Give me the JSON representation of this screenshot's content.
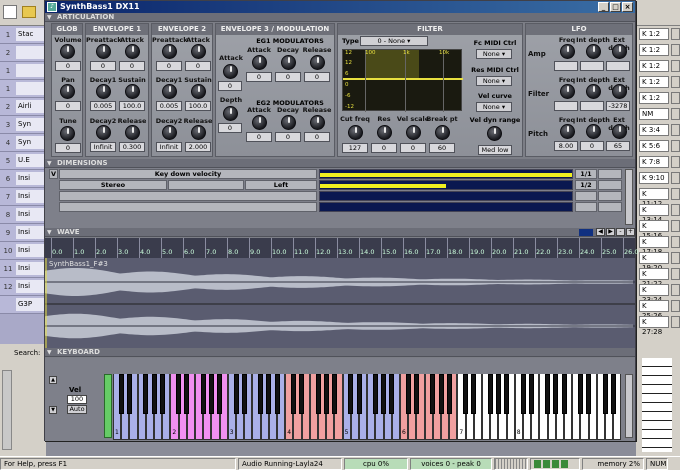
{
  "window": {
    "title": "SynthBass1 DX11"
  },
  "host": {
    "tracks": [
      {
        "num": "1",
        "name": "Stac"
      },
      {
        "num": "2",
        "name": ""
      },
      {
        "num": "1",
        "name": ""
      },
      {
        "num": "1",
        "name": ""
      },
      {
        "num": "2",
        "name": "Airli"
      },
      {
        "num": "3",
        "name": "Syn"
      },
      {
        "num": "4",
        "name": "Syn"
      },
      {
        "num": "5",
        "name": "U.E"
      },
      {
        "num": "6",
        "name": "Insi"
      },
      {
        "num": "7",
        "name": "Insi"
      },
      {
        "num": "8",
        "name": "Insi"
      },
      {
        "num": "9",
        "name": "Insi"
      },
      {
        "num": "10",
        "name": "Insi"
      },
      {
        "num": "11",
        "name": "Insi"
      },
      {
        "num": "12",
        "name": "Insi"
      },
      {
        "num": "",
        "name": "G3P"
      }
    ],
    "right_values": [
      "K 1:2",
      "K 1:2",
      "K 1:2",
      "K 1:2",
      "K 1:2",
      "NM",
      "K 3:4",
      "K 5:6",
      "K 7:8",
      "K 9:10",
      "K 11:12",
      "K 13:14",
      "K 15:16",
      "K 17:18",
      "K 19:20",
      "K 21:22",
      "K 23:24",
      "K 25:26",
      "K 27:28"
    ],
    "search_label": "Search:"
  },
  "sections": {
    "articulation": "ARTICULATION",
    "dimensions": "DIMENSIONS",
    "wave": "WAVE",
    "keyboard": "KEYBOARD"
  },
  "glob": {
    "title": "GLOB",
    "volume_label": "Volume",
    "volume_value": "0",
    "pan_label": "Pan",
    "pan_value": "0",
    "tune_label": "Tune",
    "tune_value": "0"
  },
  "env1": {
    "title": "ENVELOPE 1",
    "labels": [
      "Preattack",
      "Attack",
      "Decay1",
      "Sustain",
      "Decay2",
      "Release"
    ],
    "values": [
      "0",
      "0",
      "0.005",
      "100.0",
      "Infinit",
      "0.300"
    ]
  },
  "env2": {
    "title": "ENVELOPE 2",
    "labels": [
      "Preattack",
      "Attack",
      "Decay1",
      "Sustain",
      "Decay2",
      "Release"
    ],
    "values": [
      "0",
      "0",
      "0.005",
      "100.0",
      "Infinit",
      "2.000"
    ]
  },
  "env3": {
    "title": "ENVELOPE 3 / MODULATION",
    "attack_label": "Attack",
    "attack_value": "0",
    "depth_label": "Depth",
    "depth_value": "0",
    "eg1_title": "EG1 MODULATORS",
    "eg2_title": "EG2 MODULATORS",
    "mod_labels": [
      "Attack",
      "Decay",
      "Release"
    ],
    "eg1_values": [
      "0",
      "0",
      "0"
    ],
    "eg2_values": [
      "0",
      "0",
      "0"
    ]
  },
  "filter": {
    "title": "FILTER",
    "type_label": "Type",
    "type_value": "0 - None",
    "graph_top": [
      "12",
      "100",
      "1k",
      "10k"
    ],
    "graph_left": [
      "12",
      "6",
      "0",
      "-6",
      "-12"
    ],
    "fc_midi_label": "Fc MIDI Ctrl",
    "fc_midi_value": "None",
    "res_midi_label": "Res MIDI Ctrl",
    "res_midi_value": "None",
    "vel_curve_label": "Vel curve",
    "vel_curve_value": "None",
    "vel_dyn_label": "Vel dyn range",
    "vel_dyn_value": "Med low",
    "knob_labels": [
      "Cut freq",
      "Res",
      "Vel scale",
      "Break pt"
    ],
    "knob_values": [
      "127",
      "0",
      "0",
      "60"
    ]
  },
  "lfo": {
    "title": "LFO",
    "col_labels": [
      "Freq",
      "Int depth",
      "Ext depth"
    ],
    "row_labels": [
      "Amp",
      "Filter",
      "Pitch"
    ],
    "amp_values": [
      "",
      "",
      ""
    ],
    "filter_values": [
      "",
      "",
      "-3278"
    ],
    "pitch_values": [
      "8.00",
      "0",
      "65"
    ]
  },
  "dimensions": {
    "v_label": "V",
    "key_down_velocity": "Key down velocity",
    "stereo": "Stereo",
    "left": "Left",
    "rows": [
      {
        "ratio": "1/1",
        "fill": 1.0
      },
      {
        "ratio": "1/2",
        "fill": 0.5
      },
      {
        "ratio": "",
        "fill": 0
      },
      {
        "ratio": "",
        "fill": 0
      }
    ]
  },
  "wave": {
    "ruler": [
      "0.0",
      "1.0",
      "2.0",
      "3.0",
      "4.0",
      "5.0",
      "6.0",
      "7.0",
      "8.0",
      "9.0",
      "10.0",
      "11.0",
      "12.0",
      "13.0",
      "14.0",
      "15.0",
      "16.0",
      "17.0",
      "18.0",
      "19.0",
      "20.0",
      "21.0",
      "22.0",
      "23.0",
      "24.0",
      "25.0",
      "26.0"
    ],
    "sample_name": "SynthBass1_F#3"
  },
  "keyboard": {
    "vel_label": "Vel",
    "vel_value": "100",
    "auto_label": "Auto",
    "octave_labels": [
      "1",
      "2",
      "3",
      "4",
      "5",
      "6",
      "7",
      "8"
    ],
    "colors": {
      "green": "#66cc66",
      "blue": "#aab0e8",
      "pink": "#f090f0",
      "red": "#f0a0a0",
      "white": "#ffffff"
    }
  },
  "status": {
    "help": "For Help, press F1",
    "audio": "Audio Running-Layla24",
    "cpu": "cpu 0%",
    "voices": "voices 0 - peak 0",
    "memory": "memory 2%",
    "num": "NUM"
  }
}
